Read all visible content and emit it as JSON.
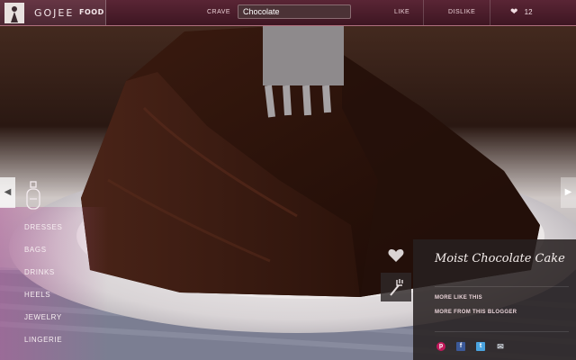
{
  "brand": {
    "name": "GOJEE",
    "section": "FOOD"
  },
  "topbar": {
    "crave_label": "CRAVE",
    "crave_value": "Chocolate",
    "like_label": "LIKE",
    "dislike_label": "DISLIKE",
    "like_count": "12"
  },
  "categories": [
    {
      "label": "DRESSES"
    },
    {
      "label": "BAGS"
    },
    {
      "label": "DRINKS"
    },
    {
      "label": "HEELS"
    },
    {
      "label": "JEWELRY"
    },
    {
      "label": "LINGERIE"
    }
  ],
  "panel": {
    "title": "Moist Chocolate Cake",
    "more_like_this": "MORE LIKE THIS",
    "more_from_blogger": "MORE FROM THIS BLOGGER"
  },
  "share_icons": [
    "pinterest-icon",
    "facebook-icon",
    "twitter-icon",
    "email-icon"
  ],
  "colors": {
    "topbar": "#4a1b2a",
    "panel": "#26201f",
    "accent_pink": "#c2185b"
  },
  "icons": {
    "prev": "chevron-left-icon",
    "next": "chevron-right-icon",
    "heart": "heart-icon",
    "fork": "fork-icon",
    "logo": "logo-figure-icon",
    "category": "perfume-bottle-icon"
  }
}
